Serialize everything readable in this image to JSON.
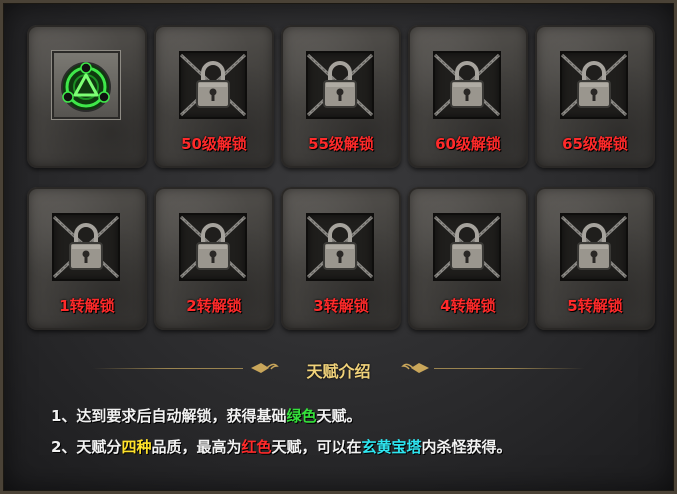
{
  "slots": [
    {
      "type": "talent",
      "icon": "talent-green-icon",
      "label": ""
    },
    {
      "type": "locked",
      "label": "50级解锁"
    },
    {
      "type": "locked",
      "label": "55级解锁"
    },
    {
      "type": "locked",
      "label": "60级解锁"
    },
    {
      "type": "locked",
      "label": "65级解锁"
    },
    {
      "type": "locked",
      "label": "1转解锁"
    },
    {
      "type": "locked",
      "label": "2转解锁"
    },
    {
      "type": "locked",
      "label": "3转解锁"
    },
    {
      "type": "locked",
      "label": "4转解锁"
    },
    {
      "type": "locked",
      "label": "5转解锁"
    }
  ],
  "intro": {
    "title": "天赋介绍",
    "line1": {
      "prefix": "1、达到要求后自动解锁，获得基础",
      "highlight": "绿色",
      "suffix": "天赋。"
    },
    "line2": {
      "part1": "2、天赋分",
      "highlight1": "四种",
      "part2": "品质，最高为",
      "highlight2": "红色",
      "part3": "天赋，可以在",
      "highlight3": "玄黄宝塔",
      "part4": "内杀怪获得。"
    }
  },
  "colors": {
    "unlock_text": "#ff2a2a",
    "title_gold": "#f0d27a",
    "green": "#35e23b",
    "yellow": "#ffe22a",
    "red": "#ff2a2a",
    "cyan": "#2ee6f0"
  }
}
